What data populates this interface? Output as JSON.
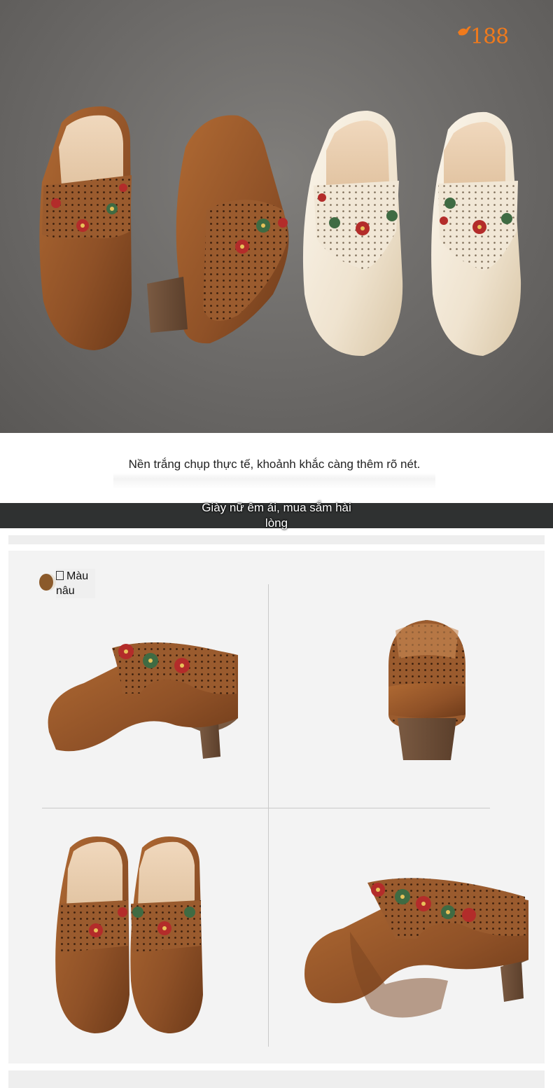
{
  "brand": {
    "number": "188",
    "tag": "",
    "accent_color": "#f07a1c"
  },
  "hero": {
    "background_color": "#6b6967",
    "shoe_colors": [
      "#9b5a2e",
      "#efe6d6"
    ]
  },
  "caption": {
    "text": "Nền trắng chụp thực tế, khoảnh khắc càng thêm rõ nét."
  },
  "banner": {
    "text": "Giày nữ êm ái, mua sắm hài lòng",
    "background_color": "#2f3131"
  },
  "product_grid": {
    "color_option": {
      "icon": "square-icon",
      "label": "Màu nâu",
      "swatch_color": "#8b5a2b"
    },
    "views": [
      "side-view",
      "back-view",
      "top-view",
      "angled-view"
    ]
  }
}
